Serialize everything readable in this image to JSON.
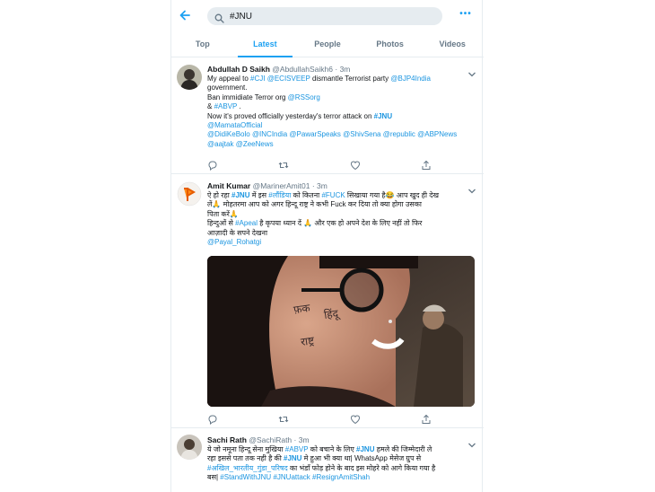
{
  "search": {
    "value": "#JNU"
  },
  "tabs": [
    "Top",
    "Latest",
    "People",
    "Photos",
    "Videos"
  ],
  "tweets": [
    {
      "name": "Abdullah D Saikh",
      "handle": "@AbdullahSaikh6",
      "time": "3m",
      "lines": [
        [
          "My appeal to ",
          {
            "l": "#CJI"
          },
          " ",
          {
            "l": "@ECISVEEP"
          },
          " dismantle Terrorist party ",
          {
            "l": "@BJP4India"
          }
        ],
        [
          " government."
        ],
        [
          "Ban immidiate Terror org ",
          {
            "l": "@RSSorg"
          }
        ],
        [
          "& ",
          {
            "l": "#ABVP"
          },
          " ."
        ],
        [
          "Now it's proved officially yesterday's terror attack on ",
          {
            "l": "#JNU",
            "b": true
          }
        ],
        [
          {
            "l": "@MamataOfficial"
          }
        ],
        [
          {
            "l": "@DidiKeBolo"
          },
          " ",
          {
            "l": "@INCIndia"
          },
          " ",
          {
            "l": "@PawarSpeaks"
          },
          " ",
          {
            "l": "@ShivSena"
          },
          " ",
          {
            "l": "@republic"
          },
          " ",
          {
            "l": "@ABPNews"
          }
        ],
        [
          {
            "l": "@aajtak"
          },
          " ",
          {
            "l": "@ZeeNews"
          }
        ]
      ]
    },
    {
      "name": "Amit Kumar",
      "handle": "@MarinerAmit01",
      "time": "3m",
      "lines": [
        [
          "ऐ हो रहा ",
          {
            "l": "#JNU",
            "b": true
          },
          " में इस ",
          {
            "l": "#लौंडिया"
          },
          " को कितना ",
          {
            "l": "#FUCK"
          },
          " सिखाया गया है😂 आप खुद ही देख"
        ],
        [
          "लें🙏 मोहतरमा आप को अगर हिन्दू राष्ट्र ने कभी Fuck कर दिया तो क्या होगा उसका"
        ],
        [
          "पिता करें🙏"
        ],
        [
          "हिन्दुओं से ",
          {
            "l": "#Apeal"
          },
          " है कृपया ध्यान दें 🙏 और एक हो अपने देश के लिए नहीं तो फिर"
        ],
        [
          "आज़ादी के सपने देखना"
        ],
        [
          {
            "l": "@Payal_Rohatgi"
          }
        ]
      ],
      "media_text": [
        "फ़क",
        "हिंदू",
        "राष्ट्र"
      ]
    },
    {
      "name": "Sachi Rath",
      "handle": "@SachiRath",
      "time": "3m",
      "lines": [
        [
          "ये जो नमूना हिन्दू सेना मुखिया ",
          {
            "l": "#ABVP"
          },
          " को बचाने के लिए ",
          {
            "l": "#JNU",
            "b": true
          },
          " हमले की जिम्मेदारी ले"
        ],
        [
          "रहा इससे पता तक नही है की ",
          {
            "l": "#JNU",
            "b": true
          },
          " मे हुआ भी क्या था| WhatsApp मेसेज ग्रुप से"
        ],
        [
          {
            "l": "#अखिल_भारतीय_गुंडा_परिषद"
          },
          " का भंडाँ फोड़ होने के बाद इस मोहरे को आगे किया गया है"
        ],
        [
          "बस| ",
          {
            "l": "#StandWithJNU"
          },
          " ",
          {
            "l": "#JNUattack"
          },
          " ",
          {
            "l": "#ResignAmitShah"
          }
        ]
      ]
    }
  ],
  "colors": {
    "accent": "#1da1f2",
    "link": "#1b95e0",
    "muted": "#657786",
    "divider": "#e6ecf0"
  }
}
